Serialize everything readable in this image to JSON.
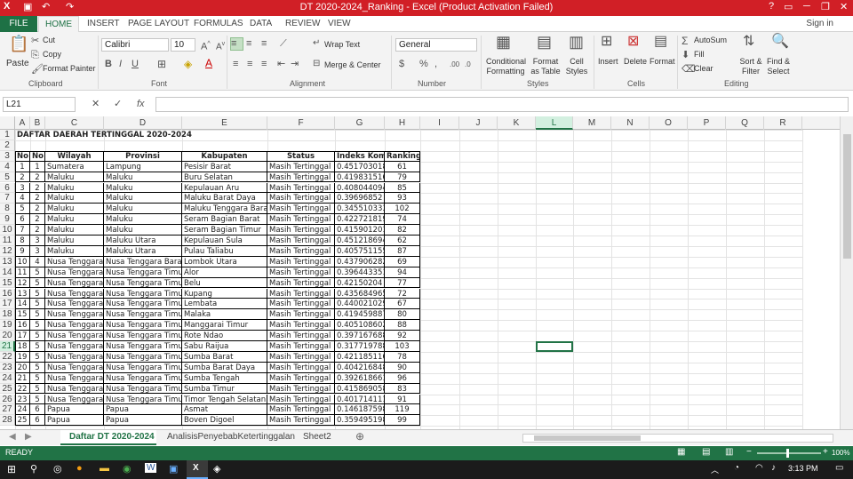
{
  "titlebar": {
    "title": "DT 2020-2024_Ranking -  Excel (Product Activation Failed)",
    "help": "?",
    "min": "─",
    "max": "❐",
    "close": "✕",
    "restore": "▭"
  },
  "tabs": {
    "file": "FILE",
    "home": "HOME",
    "insert": "INSERT",
    "page_layout": "PAGE LAYOUT",
    "formulas": "FORMULAS",
    "data": "DATA",
    "review": "REVIEW",
    "view": "VIEW",
    "signin": "Sign in"
  },
  "ribbon": {
    "paste": "Paste",
    "cut": "Cut",
    "copy": "Copy",
    "format_painter": "Format Painter",
    "clipboard": "Clipboard",
    "font_name": "Calibri",
    "font_size": "10",
    "font": "Font",
    "wrap_text": "Wrap Text",
    "merge_center": "Merge & Center",
    "alignment": "Alignment",
    "number_format": "General",
    "number": "Number",
    "conditional_formatting": "Conditional Formatting",
    "format_as_table": "Format as Table",
    "cell_styles": "Cell Styles",
    "styles": "Styles",
    "insert": "Insert",
    "delete": "Delete",
    "format": "Format",
    "cells": "Cells",
    "autosum": "AutoSum",
    "fill": "Fill",
    "clear": "Clear",
    "sort_filter": "Sort & Filter",
    "find_select": "Find & Select",
    "editing": "Editing"
  },
  "formula_bar": {
    "name_box": "L21",
    "fx": "fx",
    "value": ""
  },
  "columns": [
    "A",
    "B",
    "C",
    "D",
    "E",
    "F",
    "G",
    "H",
    "I",
    "J",
    "K",
    "L",
    "M",
    "N",
    "O",
    "P",
    "Q",
    "R"
  ],
  "sheet": {
    "title": "DAFTAR DAERAH TERTINGGAL 2020-2024",
    "headers": [
      "No",
      "No",
      "Wilayah",
      "Provinsi",
      "Kabupaten",
      "Status",
      "Indeks Komposit",
      "Ranking"
    ],
    "rows": [
      [
        "1",
        "1",
        "Sumatera",
        "Lampung",
        "Pesisir Barat",
        "Masih Tertinggal",
        "0.451703018",
        "61"
      ],
      [
        "2",
        "2",
        "Maluku",
        "Maluku",
        "Buru Selatan",
        "Masih Tertinggal",
        "0.419831516",
        "79"
      ],
      [
        "3",
        "2",
        "Maluku",
        "Maluku",
        "Kepulauan Aru",
        "Masih Tertinggal",
        "0.408044094",
        "85"
      ],
      [
        "4",
        "2",
        "Maluku",
        "Maluku",
        "Maluku Barat Daya",
        "Masih Tertinggal",
        "0.39696852",
        "93"
      ],
      [
        "5",
        "2",
        "Maluku",
        "Maluku",
        "Maluku Tenggara Barat",
        "Masih Tertinggal",
        "0.345510333",
        "102"
      ],
      [
        "6",
        "2",
        "Maluku",
        "Maluku",
        "Seram Bagian Barat",
        "Masih Tertinggal",
        "0.422721819",
        "74"
      ],
      [
        "7",
        "2",
        "Maluku",
        "Maluku",
        "Seram Bagian Timur",
        "Masih Tertinggal",
        "0.415901201",
        "82"
      ],
      [
        "8",
        "3",
        "Maluku",
        "Maluku Utara",
        "Kepulauan Sula",
        "Masih Tertinggal",
        "0.451218694",
        "62"
      ],
      [
        "9",
        "3",
        "Maluku",
        "Maluku Utara",
        "Pulau Taliabu",
        "Masih Tertinggal",
        "0.405751155",
        "87"
      ],
      [
        "10",
        "4",
        "Nusa Tenggara",
        "Nusa Tenggara Barat",
        "Lombok Utara",
        "Masih Tertinggal",
        "0.437906282",
        "69"
      ],
      [
        "11",
        "5",
        "Nusa Tenggara",
        "Nusa Tenggara Timur",
        "Alor",
        "Masih Tertinggal",
        "0.396443351",
        "94"
      ],
      [
        "12",
        "5",
        "Nusa Tenggara",
        "Nusa Tenggara Timur",
        "Belu",
        "Masih Tertinggal",
        "0.42150204",
        "77"
      ],
      [
        "13",
        "5",
        "Nusa Tenggara",
        "Nusa Tenggara Timur",
        "Kupang",
        "Masih Tertinggal",
        "0.435684965",
        "72"
      ],
      [
        "14",
        "5",
        "Nusa Tenggara",
        "Nusa Tenggara Timur",
        "Lembata",
        "Masih Tertinggal",
        "0.440021029",
        "67"
      ],
      [
        "15",
        "5",
        "Nusa Tenggara",
        "Nusa Tenggara Timur",
        "Malaka",
        "Masih Tertinggal",
        "0.419459887",
        "80"
      ],
      [
        "16",
        "5",
        "Nusa Tenggara",
        "Nusa Tenggara Timur",
        "Manggarai Timur",
        "Masih Tertinggal",
        "0.405108602",
        "88"
      ],
      [
        "17",
        "5",
        "Nusa Tenggara",
        "Nusa Tenggara Timur",
        "Rote Ndao",
        "Masih Tertinggal",
        "0.397167688",
        "92"
      ],
      [
        "18",
        "5",
        "Nusa Tenggara",
        "Nusa Tenggara Timur",
        "Sabu Raijua",
        "Masih Tertinggal",
        "0.317719788",
        "103"
      ],
      [
        "19",
        "5",
        "Nusa Tenggara",
        "Nusa Tenggara Timur",
        "Sumba Barat",
        "Masih Tertinggal",
        "0.421185116",
        "78"
      ],
      [
        "20",
        "5",
        "Nusa Tenggara",
        "Nusa Tenggara Timur",
        "Sumba Barat Daya",
        "Masih Tertinggal",
        "0.404216848",
        "90"
      ],
      [
        "21",
        "5",
        "Nusa Tenggara",
        "Nusa Tenggara Timur",
        "Sumba Tengah",
        "Masih Tertinggal",
        "0.392618661",
        "96"
      ],
      [
        "22",
        "5",
        "Nusa Tenggara",
        "Nusa Tenggara Timur",
        "Sumba Timur",
        "Masih Tertinggal",
        "0.415869058",
        "83"
      ],
      [
        "23",
        "5",
        "Nusa Tenggara",
        "Nusa Tenggara Timur",
        "Timor Tengah Selatan",
        "Masih Tertinggal",
        "0.401714111",
        "91"
      ],
      [
        "24",
        "6",
        "Papua",
        "Papua",
        "Asmat",
        "Masih Tertinggal",
        "0.146187598",
        "119"
      ],
      [
        "25",
        "6",
        "Papua",
        "Papua",
        "Boven Digoel",
        "Masih Tertinggal",
        "0.359495198",
        "99"
      ]
    ]
  },
  "sheet_tabs": [
    "Daftar DT 2020-2024",
    "AnalisisPenyebabKetertinggalan",
    "Sheet2"
  ],
  "status": {
    "ready": "READY",
    "zoom": "100%"
  },
  "taskbar": {
    "time": "3:13 PM"
  }
}
